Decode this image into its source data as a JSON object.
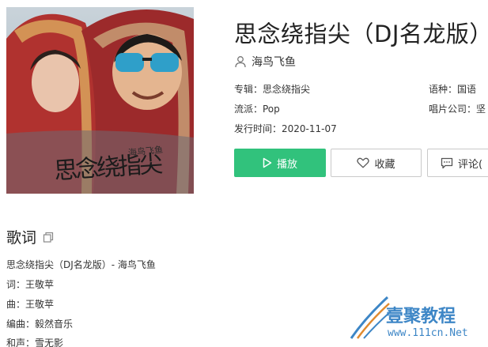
{
  "song": {
    "title": "思念绕指尖（DJ名龙版）",
    "artist": "海鸟飞鱼",
    "cover_title": "思念绕指尖",
    "cover_artist": "海鸟飞鱼"
  },
  "meta": {
    "album": "专辑：思念绕指尖",
    "language": "语种：国语",
    "genre": "流派：Pop",
    "label": "唱片公司：坚",
    "release": "发行时间：2020-11-07"
  },
  "buttons": {
    "play": "播放",
    "favorite": "收藏",
    "comment": "评论("
  },
  "lyrics": {
    "heading": "歌词",
    "lines": [
      "思念绕指尖（DJ名龙版）- 海鸟飞鱼",
      "词：王敬苹",
      "曲：王敬苹",
      "编曲：毅然音乐",
      "和声：雪无影"
    ]
  },
  "watermark": {
    "text": "壹聚教程",
    "url": "www.111cn.Net"
  },
  "colors": {
    "play_green": "#31c27c",
    "watermark_blue": "#3d86c6"
  }
}
